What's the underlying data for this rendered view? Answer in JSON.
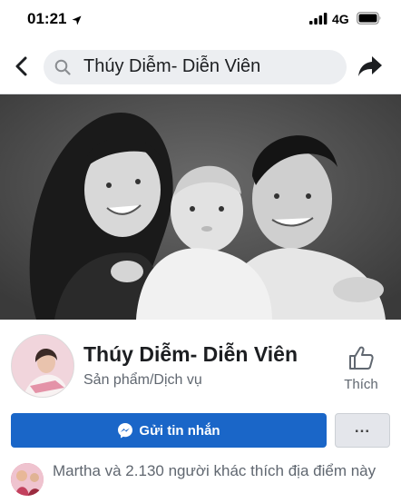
{
  "status_bar": {
    "time": "01:21",
    "network": "4G"
  },
  "nav": {
    "search_text": "Thúy Diễm- Diễn Viên"
  },
  "page": {
    "name": "Thúy Diễm- Diễn Viên",
    "category": "Sản phẩm/Dịch vụ",
    "like_label": "Thích",
    "message_label": "Gửi tin nhắn",
    "more_label": "...",
    "social_text": "Martha và 2.130 người khác thích địa điểm này"
  },
  "colors": {
    "primary": "#1a66c8",
    "secondary_text": "#606770",
    "search_bg": "#eceef1"
  },
  "icons": [
    "location-arrow-icon",
    "signal-icon",
    "battery-icon",
    "back-icon",
    "search-icon",
    "share-icon",
    "like-icon",
    "messenger-icon"
  ]
}
